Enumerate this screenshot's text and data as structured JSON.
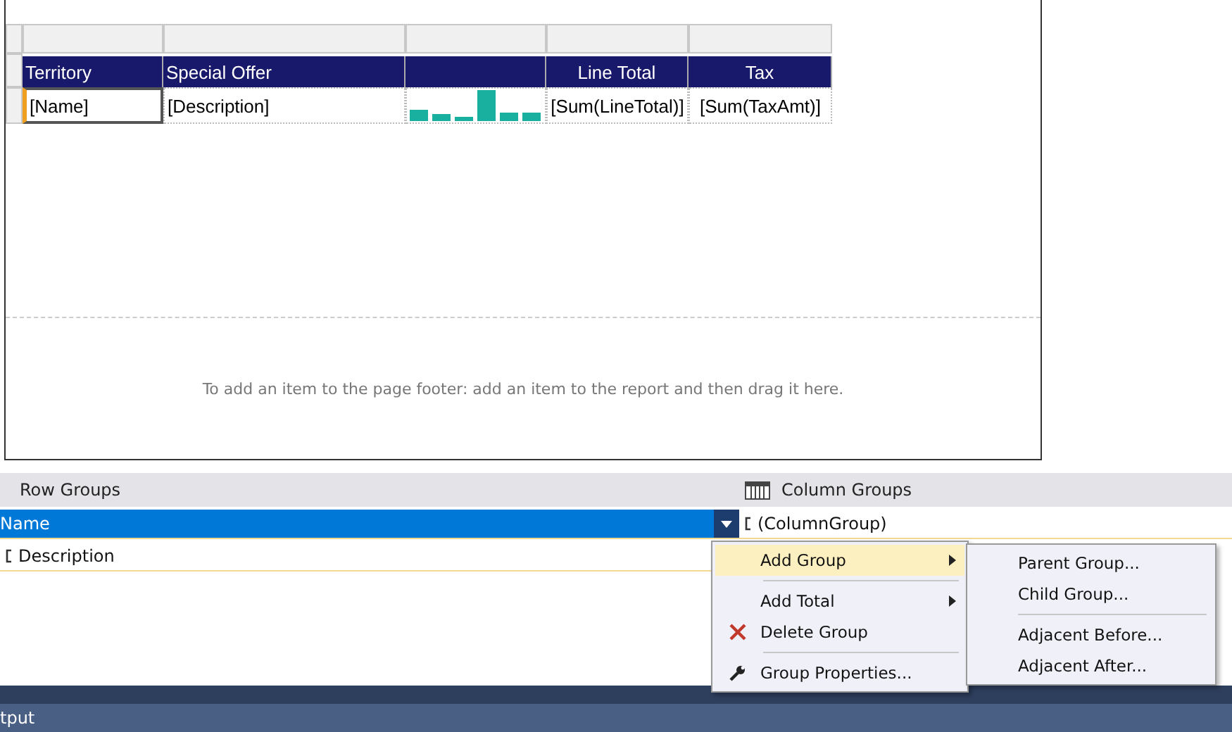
{
  "report": {
    "columns": [
      {
        "header": "Territory",
        "cell": "[Name]",
        "selected": true,
        "kind": "label"
      },
      {
        "header": "Special Offer",
        "cell": "[Description]",
        "selected": false,
        "kind": "label"
      },
      {
        "selected": false,
        "kind": "sparkline"
      },
      {
        "header": "Line Total",
        "cell": "[Sum(LineTotal)]",
        "selected": false,
        "kind": "amount"
      },
      {
        "header": "Tax",
        "cell": "[Sum(TaxAmt)]",
        "selected": false,
        "kind": "amount"
      }
    ],
    "footer_hint": "To add an item to the page footer: add an item to the report and then drag it here."
  },
  "row_groups": {
    "title": "Row Groups",
    "items": [
      {
        "label": "Name",
        "selected": true
      },
      {
        "label": "Description",
        "selected": false
      }
    ]
  },
  "column_groups": {
    "title": "Column Groups",
    "items": [
      {
        "label": "(ColumnGroup)"
      }
    ]
  },
  "context_menu": {
    "items": [
      {
        "label": "Add Group",
        "kind": "plain",
        "submenu": true,
        "selected": true,
        "separator_before": false
      },
      {
        "label": "Add Total",
        "kind": "plain",
        "submenu": true,
        "selected": false,
        "separator_before": true
      },
      {
        "label": "Delete Group",
        "kind": "delete",
        "submenu": false,
        "selected": false,
        "separator_before": false
      },
      {
        "label": "Group Properties...",
        "kind": "properties",
        "submenu": false,
        "selected": false,
        "separator_before": true
      }
    ]
  },
  "submenu": {
    "items": [
      {
        "label": "Parent Group...",
        "separator_before": false
      },
      {
        "label": "Child Group...",
        "separator_before": false
      },
      {
        "label": "Adjacent Before...",
        "separator_before": true
      },
      {
        "label": "Adjacent After...",
        "separator_before": false
      }
    ]
  },
  "output_panel": {
    "title": "tput"
  }
}
